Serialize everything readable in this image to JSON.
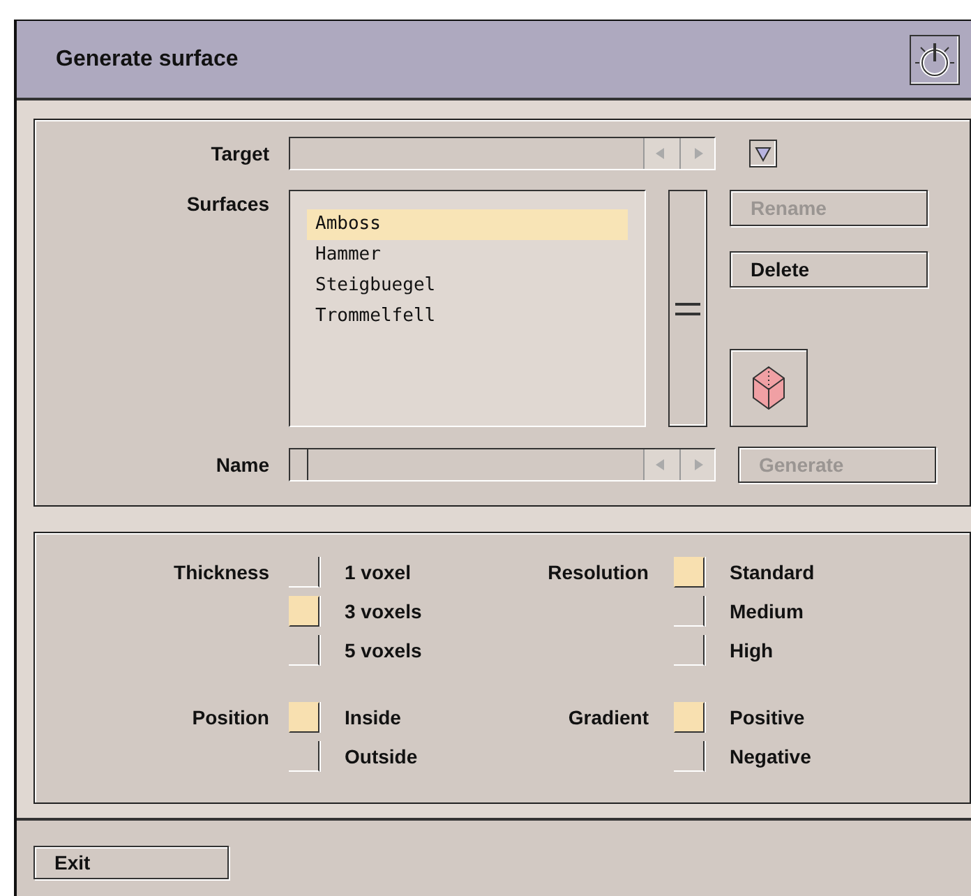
{
  "window": {
    "title": "Generate surface"
  },
  "target": {
    "label": "Target"
  },
  "surfaces": {
    "label": "Surfaces",
    "items": [
      {
        "name": "Amboss",
        "selected": true
      },
      {
        "name": "Hammer",
        "selected": false
      },
      {
        "name": "Steigbuegel",
        "selected": false
      },
      {
        "name": "Trommelfell",
        "selected": false
      }
    ]
  },
  "side_buttons": [
    {
      "label": "Rename",
      "disabled": true
    },
    {
      "label": "Delete",
      "disabled": false
    }
  ],
  "name": {
    "label": "Name"
  },
  "generate_button": {
    "label": "Generate",
    "disabled": true
  },
  "option_groups": [
    {
      "label": "Thickness",
      "options": [
        {
          "label": "1 voxel",
          "selected": false
        },
        {
          "label": "3 voxels",
          "selected": true
        },
        {
          "label": "5 voxels",
          "selected": false
        }
      ]
    },
    {
      "label": "Resolution",
      "options": [
        {
          "label": "Standard",
          "selected": true
        },
        {
          "label": "Medium",
          "selected": false
        },
        {
          "label": "High",
          "selected": false
        }
      ]
    },
    {
      "label": "Position",
      "options": [
        {
          "label": "Inside",
          "selected": true
        },
        {
          "label": "Outside",
          "selected": false
        }
      ]
    },
    {
      "label": "Gradient",
      "options": [
        {
          "label": "Positive",
          "selected": true
        },
        {
          "label": "Negative",
          "selected": false
        }
      ]
    }
  ],
  "exit_button": {
    "label": "Exit"
  }
}
